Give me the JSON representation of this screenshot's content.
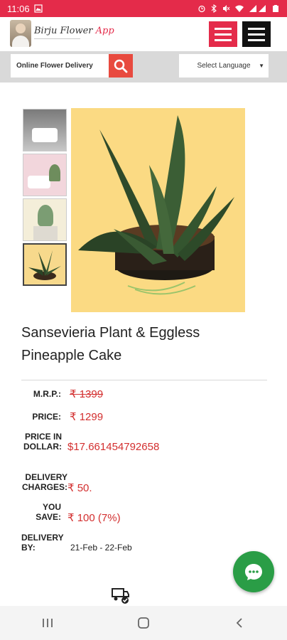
{
  "status_bar": {
    "time": "11:06",
    "background": "#e42b4a"
  },
  "header": {
    "logo_title": "Birju Flower",
    "logo_app": "App",
    "menu_red_color": "#e42b4a",
    "menu_black_color": "#111111"
  },
  "search": {
    "placeholder": "Online Flower Delivery",
    "button_icon": "search-icon",
    "button_color": "#e84a3f"
  },
  "language": {
    "selected": "Select Language",
    "caret_icon": "caret-down-icon"
  },
  "product": {
    "title": "Sansevieria Plant & Eggless Pineapple Cake",
    "thumbnails": [
      "cake-thumbnail",
      "cake-plant-thumbnail",
      "plant-pot-thumbnail",
      "sansevieria-thumbnail"
    ],
    "selected_thumbnail_index": 3
  },
  "pricing": {
    "mrp_label": "M.R.P.:",
    "mrp_value": "₹ 1399",
    "price_label": "PRICE:",
    "price_value": "₹ 1299",
    "dollar_label": "PRICE IN DOLLAR:",
    "dollar_value": "$17.661454792658",
    "delivery_label": "DELIVERY CHARGES:",
    "delivery_value": "₹ 50.",
    "save_label": "YOU SAVE:",
    "save_value": "₹ 100 (7%)",
    "date_label": "DELIVERY BY:",
    "date_value": "21-Feb - 22-Feb",
    "price_color": "#d32f2f"
  },
  "fab": {
    "icon": "chat-bubble-icon",
    "color": "#2a9d46"
  },
  "nav": {
    "recents_icon": "recents-icon",
    "home_icon": "home-icon",
    "back_icon": "back-icon"
  }
}
